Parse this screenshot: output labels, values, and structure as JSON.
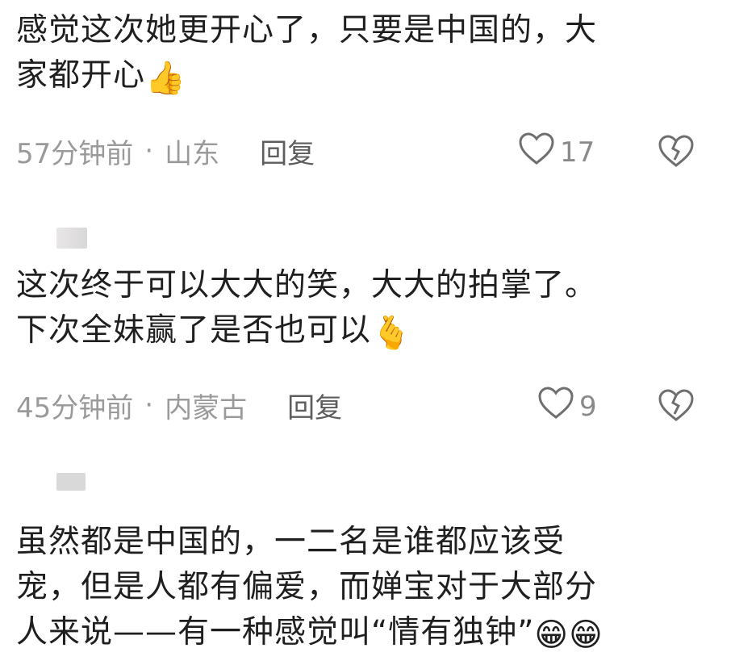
{
  "comments": [
    {
      "text_line1": "感觉这次她更开心了，只要是中国的，大",
      "text_line2": "家都开心",
      "emoji": "👍",
      "time": "57分钟前",
      "sep": "·",
      "location": "山东",
      "reply_label": "回复",
      "likes": "17"
    },
    {
      "text_line1": "这次终于可以大大的笑，大大的拍掌了。",
      "text_line2": "下次全妹赢了是否也可以",
      "emoji": "🫰",
      "time": "45分钟前",
      "sep": "·",
      "location": "内蒙古",
      "reply_label": "回复",
      "likes": "9"
    },
    {
      "text_line1": "虽然都是中国的，一二名是谁都应该受",
      "text_line2": "宠，但是人都有偏爱，而婵宝对于大部分",
      "text_line3": "人来说——有一种感觉叫“情有独钟”",
      "emoji": "😁😁"
    }
  ],
  "icons": {
    "like": "heart-outline-icon",
    "dislike": "broken-heart-icon"
  },
  "colors": {
    "text": "#1f1f1f",
    "meta": "#9a9a9a",
    "reply": "#5d5d5d"
  }
}
